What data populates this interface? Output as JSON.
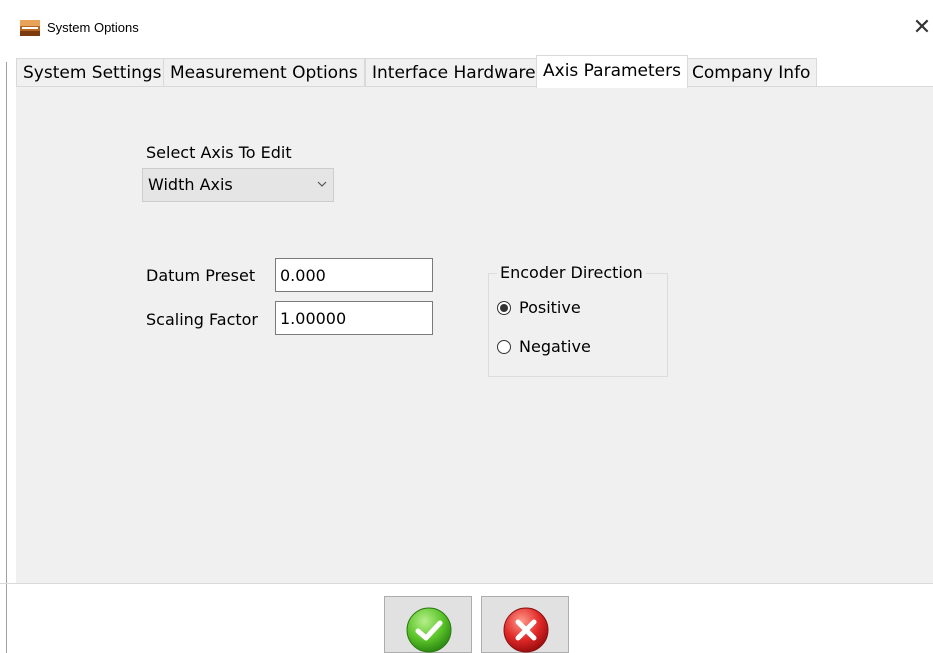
{
  "window": {
    "title": "System Options",
    "app_icon": "wood-measure-app-icon",
    "close_glyph": "✕"
  },
  "tabs": [
    {
      "label": "System Settings",
      "active": false
    },
    {
      "label": "Measurement Options",
      "active": false
    },
    {
      "label": "Interface Hardware",
      "active": false
    },
    {
      "label": "Axis Parameters",
      "active": true
    },
    {
      "label": "Company Info",
      "active": false
    }
  ],
  "axis_params": {
    "select_axis_label": "Select Axis To Edit",
    "selected_axis": "Width Axis",
    "datum_preset_label": "Datum Preset",
    "datum_preset_value": "0.000",
    "scaling_factor_label": "Scaling Factor",
    "scaling_factor_value": "1.00000",
    "encoder_direction": {
      "title": "Encoder Direction",
      "options": [
        {
          "label": "Positive",
          "checked": true
        },
        {
          "label": "Negative",
          "checked": false
        }
      ]
    }
  },
  "footer": {
    "ok_icon": "green-check-icon",
    "cancel_icon": "red-x-icon"
  },
  "colors": {
    "panel_bg": "#f0f0f0",
    "ok_green": "#5cc42a",
    "cancel_red": "#e02828"
  }
}
